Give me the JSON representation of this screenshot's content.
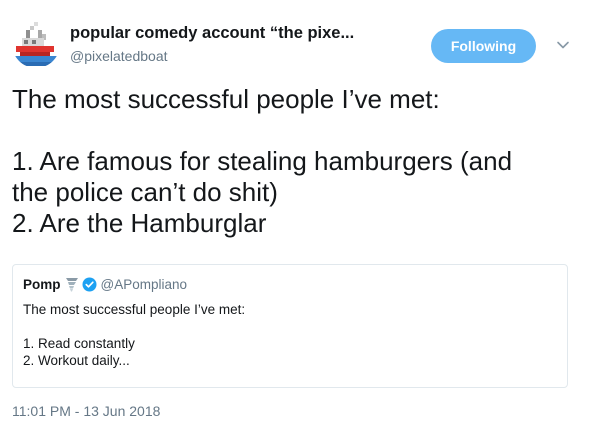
{
  "author": {
    "display_name": "popular comedy account “the pixe...",
    "handle": "@pixelatedboat",
    "avatar_icon": "pixel-boat-avatar-icon"
  },
  "follow_button": {
    "label": "Following"
  },
  "menu": {
    "icon": "chevron-down-icon"
  },
  "tweet": {
    "line1": "The most successful people I’ve met:",
    "line2": "1. Are famous for stealing hamburgers (and",
    "line3": "the police can’t do shit)",
    "line4": "2. Are the Hamburglar"
  },
  "quoted_tweet": {
    "name": "Pomp",
    "emoji_icon": "tornado-emoji-icon",
    "verified_icon": "verified-badge-icon",
    "handle": "@APompliano",
    "line1": "The most successful people I’ve met:",
    "line2": "1. Read constantly",
    "line3": "2. Workout daily..."
  },
  "timestamp": "11:01 PM - 13 Jun 2018",
  "colors": {
    "follow_button_bg": "#66b8f5",
    "secondary_text": "#657786",
    "verified_blue": "#1da1f2",
    "border": "#e1e8ed"
  }
}
